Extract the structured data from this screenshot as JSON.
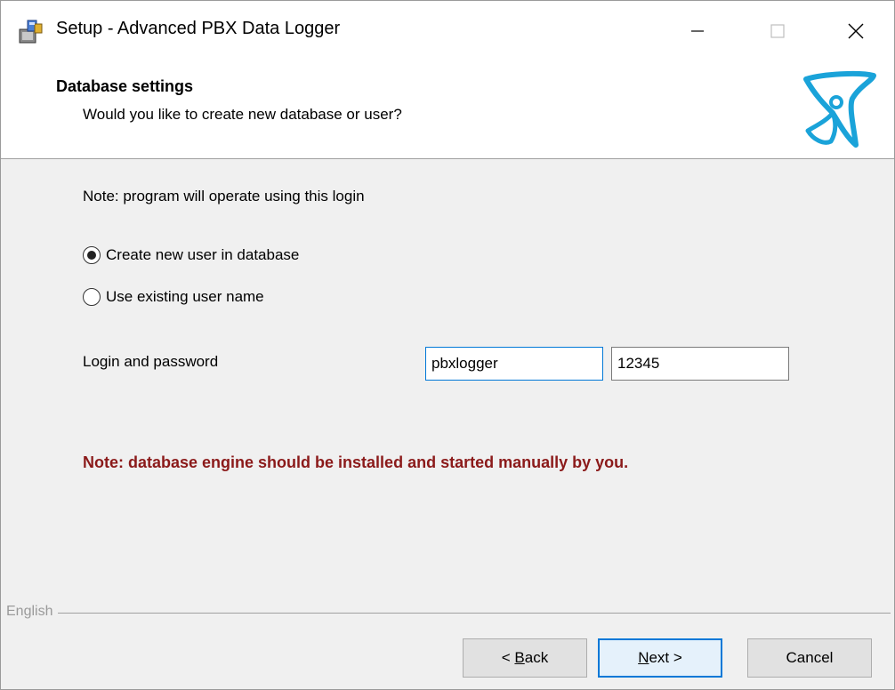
{
  "window": {
    "title": "Setup - Advanced PBX Data Logger"
  },
  "header": {
    "title": "Database settings",
    "subtitle": "Would you like to create new database or user?"
  },
  "body": {
    "note": "Note: program will operate using this login",
    "radio_options": [
      {
        "label": "Create new user in database",
        "selected": true
      },
      {
        "label": "Use existing user name",
        "selected": false
      }
    ],
    "login_label": "Login and password",
    "login_value": "pbxlogger",
    "password_value": "12345",
    "warning": "Note: database engine should be installed and started manually by you."
  },
  "footer": {
    "language": "English",
    "back_mnemonic": "B",
    "back_rest": "ack",
    "back_prefix": "< ",
    "next_mnemonic": "N",
    "next_rest": "ext >",
    "cancel_label": "Cancel"
  },
  "colors": {
    "warning": "#8b1a1a",
    "accent": "#0078d7",
    "logo": "#1aa3d9"
  }
}
